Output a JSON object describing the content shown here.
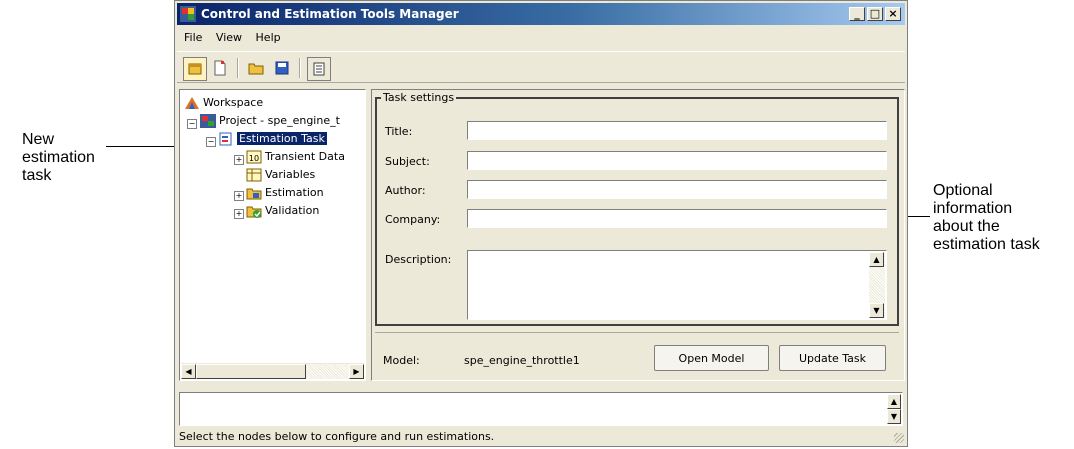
{
  "annotations": {
    "left": [
      "New",
      "estimation",
      "task"
    ],
    "right": [
      "Optional",
      "information",
      "about the",
      "estimation task"
    ]
  },
  "window": {
    "title": "Control and Estimation Tools Manager",
    "controls": {
      "minimize": "_",
      "maximize": "□",
      "close": "×"
    }
  },
  "menu": [
    "File",
    "View",
    "Help"
  ],
  "toolbar": {
    "icons": [
      "new-project-icon",
      "new-task-icon",
      "open-icon",
      "save-icon",
      "notes-icon"
    ]
  },
  "tree": {
    "root": "Workspace",
    "project": "Project - spe_engine_t",
    "task": "Estimation Task",
    "children": [
      "Transient Data",
      "Variables",
      "Estimation",
      "Validation"
    ]
  },
  "task_settings": {
    "legend": "Task settings",
    "title_label": "Title:",
    "title_value": "",
    "subject_label": "Subject:",
    "subject_value": "",
    "author_label": "Author:",
    "author_value": "",
    "company_label": "Company:",
    "company_value": "",
    "description_label": "Description:",
    "description_value": ""
  },
  "model": {
    "label": "Model:",
    "value": "spe_engine_throttle1",
    "open_button": "Open Model",
    "update_button": "Update Task"
  },
  "console": {
    "text": ""
  },
  "status": {
    "text": "Select the nodes below to configure and run estimations."
  },
  "colors": {
    "title_gradient_start": "#0a246a",
    "title_gradient_end": "#a6caf0",
    "window_face": "#ece9d8",
    "selection": "#0a246a"
  }
}
